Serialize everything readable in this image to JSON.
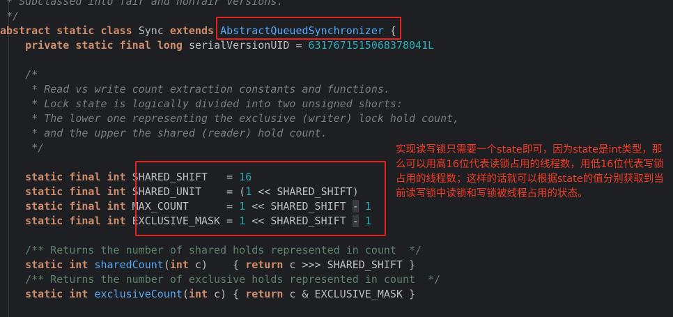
{
  "code": {
    "l0": " * Subclassed into fair and nonfair versions.",
    "l1": " */",
    "l2": {
      "kw": "abstract static class ",
      "name": "Sync ",
      "ext": "extends ",
      "sup": "AbstractQueuedSynchronizer",
      "brace": " {"
    },
    "l3": {
      "kw": "    private static final long ",
      "name": "serialVersionUID",
      "eq": " = ",
      "val": "6317671515068378041L"
    },
    "l5": "    /*",
    "l6": "     * Read vs write count extraction constants and functions.",
    "l7": "     * Lock state is logically divided into two unsigned shorts:",
    "l8": "     * The lower one representing the exclusive (writer) lock hold count,",
    "l9": "     * and the upper the shared (reader) hold count.",
    "l10": "     */",
    "const_kw": "    static final int ",
    "c1": {
      "name": "SHARED_SHIFT",
      "pad": "   = ",
      "val": "16"
    },
    "c2": {
      "name": "SHARED_UNIT",
      "pad": "    = (",
      "one": "1",
      "shift": " << SHARED_SHIFT)"
    },
    "c3": {
      "name": "MAX_COUNT",
      "pad": "      = ",
      "one": "1",
      "shift": " << SHARED_SHIFT ",
      "minus": "-",
      "sp": " ",
      "val": "1"
    },
    "c4": {
      "name": "EXCLUSIVE_MASK",
      "pad": " = ",
      "one": "1",
      "shift": " << SHARED_SHIFT ",
      "minus": "-",
      "sp": " ",
      "val": "1"
    },
    "d1": "    /** Returns the number of shared holds represented in count  */",
    "m1": {
      "kw1": "    static int ",
      "name": "sharedCount",
      "open": "(",
      "kw2": "int",
      "rest": " c)    { ",
      "kw3": "return",
      "body": " c >>> SHARED_SHIFT }"
    },
    "d2": "    /** Returns the number of exclusive holds represented in count  */",
    "m2": {
      "kw1": "    static int ",
      "name": "exclusiveCount",
      "open": "(",
      "kw2": "int",
      "rest": " c) { ",
      "kw3": "return",
      "body": " c & EXCLUSIVE_MASK }"
    }
  },
  "annotation": "实现读写锁只需要一个state即可，因为state是int类型，那么可以用高16位代表读锁占用的线程数，用低16位代表写锁占用的线程数；这样的话就可以根据state的值分别获取到当前读写锁中读锁和写锁被线程占用的状态。",
  "colors": {
    "background": "#1e1f22",
    "keyword": "#cf8e6d",
    "number": "#2aacb8",
    "comment": "#7a7e85",
    "highlight_box": "#e8221e",
    "annotation_text": "#f23b26"
  }
}
